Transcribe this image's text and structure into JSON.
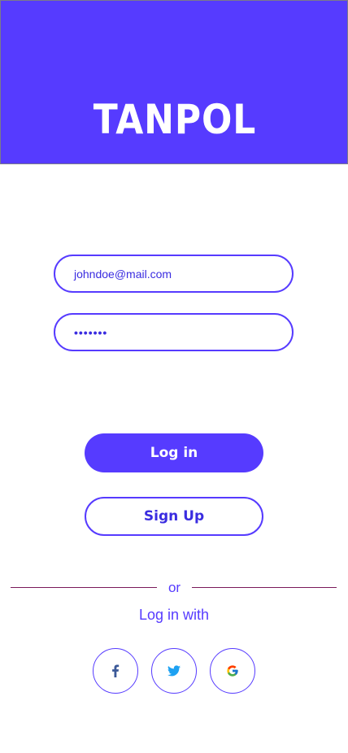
{
  "header": {
    "logo_text": "TANPOL",
    "background": "#563bff"
  },
  "login_form": {
    "email_value": "johndoe@mail.com",
    "password_value": "•••••••"
  },
  "buttons": {
    "login_label": "Log in",
    "signup_label": "Sign Up"
  },
  "social_section": {
    "divider_text": "or",
    "login_with_text": "Log in with",
    "providers": [
      {
        "name": "facebook",
        "icon": "facebook-icon"
      },
      {
        "name": "twitter",
        "icon": "twitter-icon"
      },
      {
        "name": "google",
        "icon": "google-icon"
      }
    ]
  },
  "colors": {
    "primary": "#563bff",
    "divider": "#7a1a5a"
  }
}
